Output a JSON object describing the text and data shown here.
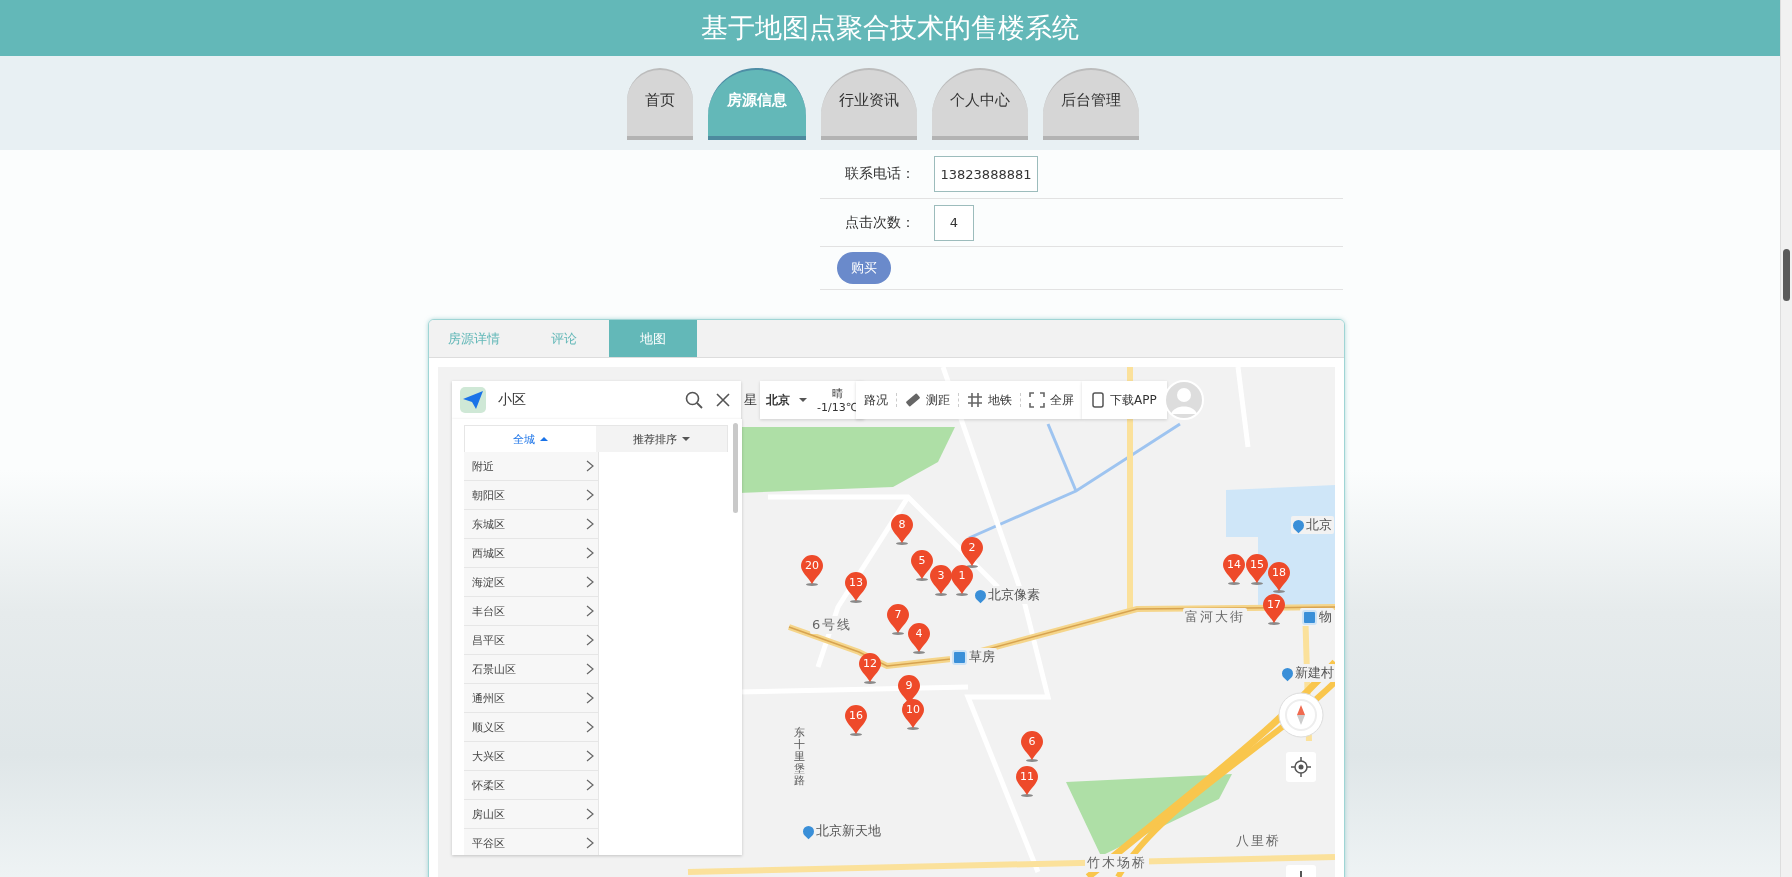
{
  "header": {
    "title": "基于地图点聚合技术的售楼系统"
  },
  "nav": [
    {
      "label": "首页",
      "selected": false
    },
    {
      "label": "房源信息",
      "selected": true
    },
    {
      "label": "行业资讯",
      "selected": false
    },
    {
      "label": "个人中心",
      "selected": false
    },
    {
      "label": "后台管理",
      "selected": false
    }
  ],
  "details": {
    "fields": [
      {
        "label": "联系电话：",
        "value": "13823888881"
      },
      {
        "label": "点击次数：",
        "value": "4"
      }
    ],
    "buy_button": "购买"
  },
  "tabs": [
    {
      "label": "房源详情",
      "selected": false
    },
    {
      "label": "评论",
      "selected": false
    },
    {
      "label": "地图",
      "selected": true
    }
  ],
  "map": {
    "search": {
      "value": "小区"
    },
    "toolbar": {
      "partial_label": "星",
      "city": "北京",
      "weather": "晴",
      "temperature": "-1/13℃",
      "download": "下载APP",
      "tools": [
        {
          "label": "路况",
          "kind": "text"
        },
        {
          "label": "测距",
          "kind": "ruler"
        },
        {
          "label": "地铁",
          "kind": "subway"
        },
        {
          "label": "全屏",
          "kind": "fullscreen"
        }
      ]
    },
    "filter_tabs": [
      {
        "label": "全城",
        "selected": true
      },
      {
        "label": "推荐排序",
        "selected": false
      }
    ],
    "districts": [
      "附近",
      "朝阳区",
      "东城区",
      "西城区",
      "海淀区",
      "丰台区",
      "昌平区",
      "石景山区",
      "通州区",
      "顺义区",
      "大兴区",
      "怀柔区",
      "房山区",
      "平谷区"
    ],
    "places": [
      {
        "label": "北京",
        "kind": "poi"
      },
      {
        "label": "北京像素",
        "kind": "poi"
      },
      {
        "label": "富河大街",
        "kind": "road"
      },
      {
        "label": "物",
        "kind": "station"
      },
      {
        "label": "6号线",
        "kind": "road"
      },
      {
        "label": "草房",
        "kind": "station"
      },
      {
        "label": "新建村",
        "kind": "poi"
      },
      {
        "label": "东十里堡路",
        "kind": "vertical"
      },
      {
        "label": "北京新天地",
        "kind": "poi"
      },
      {
        "label": "八里桥",
        "kind": "road"
      },
      {
        "label": "竹木场桥",
        "kind": "road"
      }
    ],
    "markers": [
      "8",
      "2",
      "20",
      "5",
      "3",
      "1",
      "13",
      "7",
      "4",
      "12",
      "9",
      "10",
      "16",
      "6",
      "11",
      "14",
      "15",
      "18",
      "17"
    ]
  }
}
